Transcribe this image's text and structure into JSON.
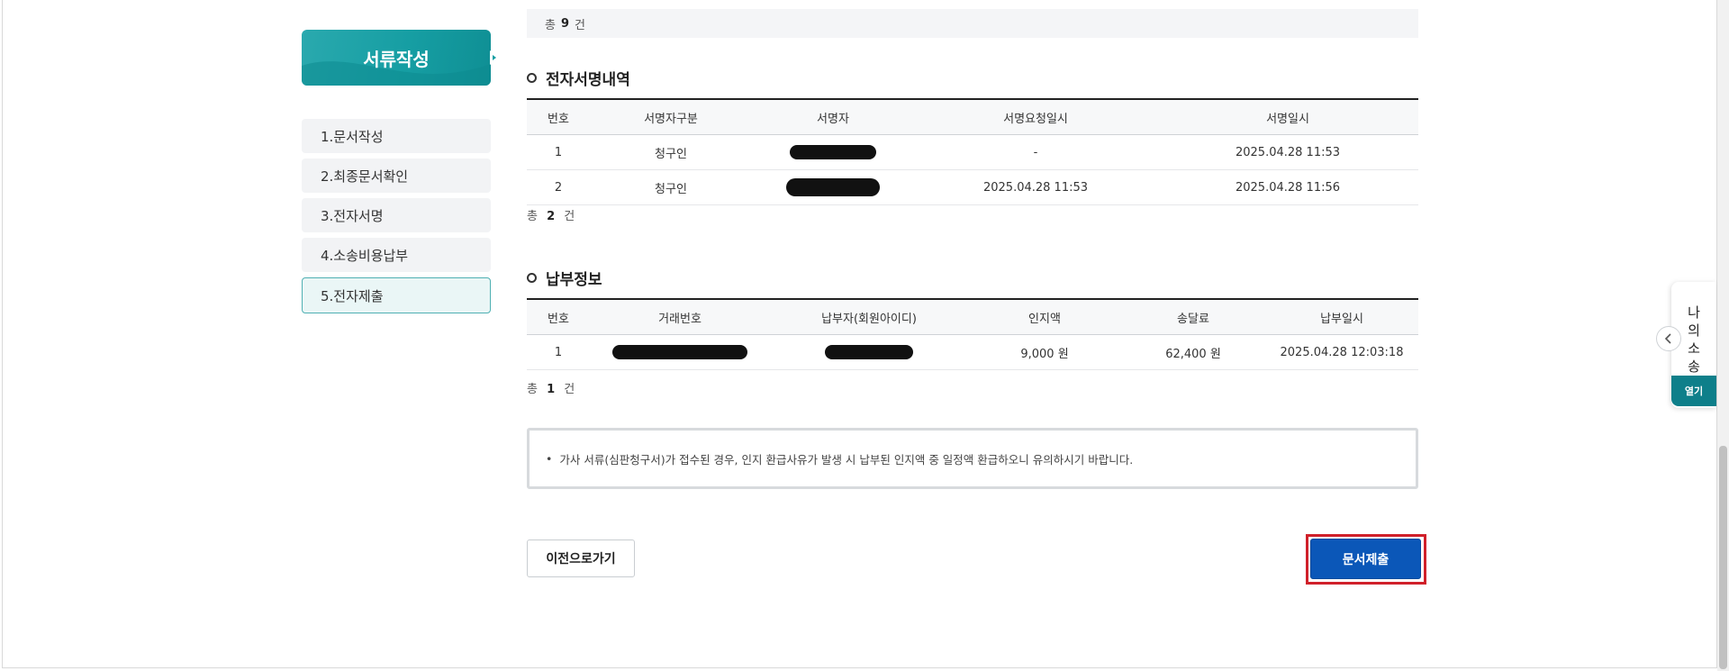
{
  "sidebar": {
    "header": "서류작성",
    "items": [
      {
        "label": "1.문서작성"
      },
      {
        "label": "2.최종문서확인"
      },
      {
        "label": "3.전자서명"
      },
      {
        "label": "4.소송비용납부"
      },
      {
        "label": "5.전자제출"
      }
    ]
  },
  "top_total": {
    "prefix": "총",
    "count": "9",
    "suffix": "건"
  },
  "signatures": {
    "title": "전자서명내역",
    "columns": [
      "번호",
      "서명자구분",
      "서명자",
      "서명요청일시",
      "서명일시"
    ],
    "rows": [
      {
        "no": "1",
        "type": "청구인",
        "request": "-",
        "signed": "2025.04.28 11:53"
      },
      {
        "no": "2",
        "type": "청구인",
        "request": "2025.04.28 11:53",
        "signed": "2025.04.28 11:56"
      }
    ],
    "total": {
      "prefix": "총",
      "count": "2",
      "suffix": "건"
    }
  },
  "payment": {
    "title": "납부정보",
    "columns": [
      "번호",
      "거래번호",
      "납부자(회원아이디)",
      "인지액",
      "송달료",
      "납부일시"
    ],
    "rows": [
      {
        "no": "1",
        "stamp": "9,000 원",
        "delivery": "62,400 원",
        "paid_at": "2025.04.28 12:03:18"
      }
    ],
    "total": {
      "prefix": "총",
      "count": "1",
      "suffix": "건"
    }
  },
  "notice": {
    "bullet": "•",
    "text": "가사 서류(심판청구서)가 접수된 경우, 인지 환급사유가 발생 시 납부된 인지액 중 일정액 환급하오니 유의하시기 바랍니다."
  },
  "buttons": {
    "prev": "이전으로가기",
    "submit": "문서제출"
  },
  "widget": {
    "label_chars": [
      "나",
      "의",
      "소",
      "송"
    ],
    "open": "열기"
  },
  "colors": {
    "accent_teal": "#169ea3",
    "submit_blue": "#0b57b8",
    "highlight_red": "#d0202a"
  },
  "icons": {
    "toggle": "chevron-left-icon"
  }
}
